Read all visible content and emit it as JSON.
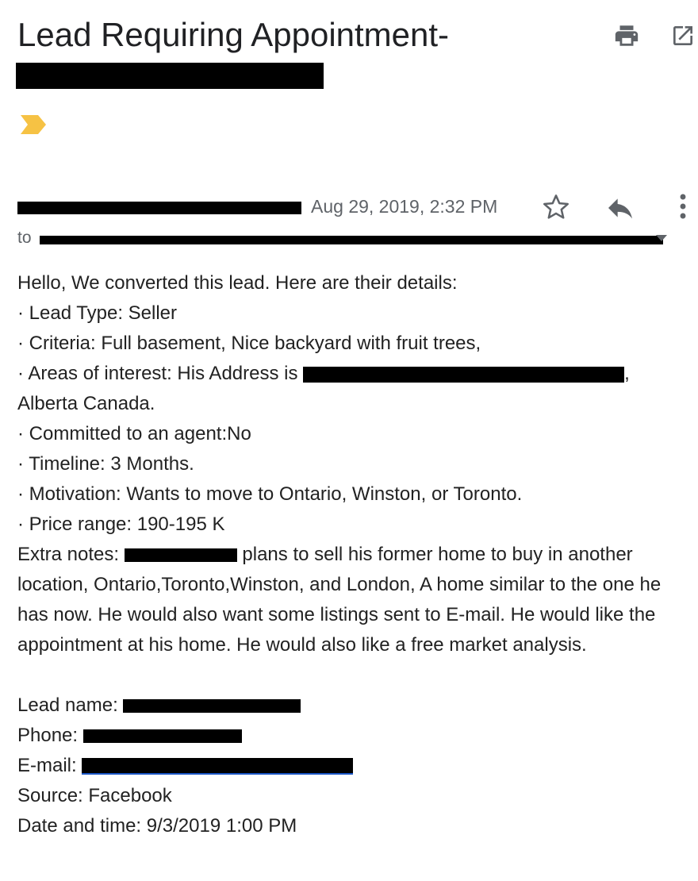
{
  "header": {
    "subject": "Lead Requiring Appointment-",
    "print_icon": "print-icon",
    "open_new_window_icon": "open-in-new-icon",
    "label_icon": "important-label-icon"
  },
  "message": {
    "date": "Aug 29, 2019, 2:32 PM",
    "to_prefix": "to",
    "star_icon": "star-icon",
    "reply_icon": "reply-icon",
    "more_icon": "more-vert-icon",
    "details_icon": "chevron-down-icon"
  },
  "body": {
    "intro": "Hello, We converted this lead. Here are their details:",
    "lead_type": "· Lead Type: Seller",
    "criteria": "· Criteria: Full basement, Nice backyard with fruit trees,",
    "areas_prefix": "· Areas of interest: His Address is",
    "areas_suffix": ",",
    "areas_line2": "Alberta Canada.",
    "committed": "· Committed to an agent:No",
    "timeline": "· Timeline: 3 Months.",
    "motivation": "· Motivation: Wants to move to Ontario, Winston, or Toronto.",
    "price_range": "· Price range: 190-195 K",
    "extra_prefix": "Extra notes:",
    "extra_text": "plans to sell his former home to buy in another location, Ontario,Toronto,Winston, and London, A home similar to the one he has now. He would also want some listings sent to E-mail. He would like the appointment at his home. He would also like a free market analysis.",
    "lead_name_label": "Lead name:",
    "phone_label": "Phone:",
    "email_label": "E-mail:",
    "source": "Source: Facebook",
    "date_time": "Date and time: 9/3/2019 1:00 PM"
  },
  "colors": {
    "label_tag": "#f6c244",
    "icon_gray": "#5f6368",
    "link_blue": "#1a55c5"
  }
}
